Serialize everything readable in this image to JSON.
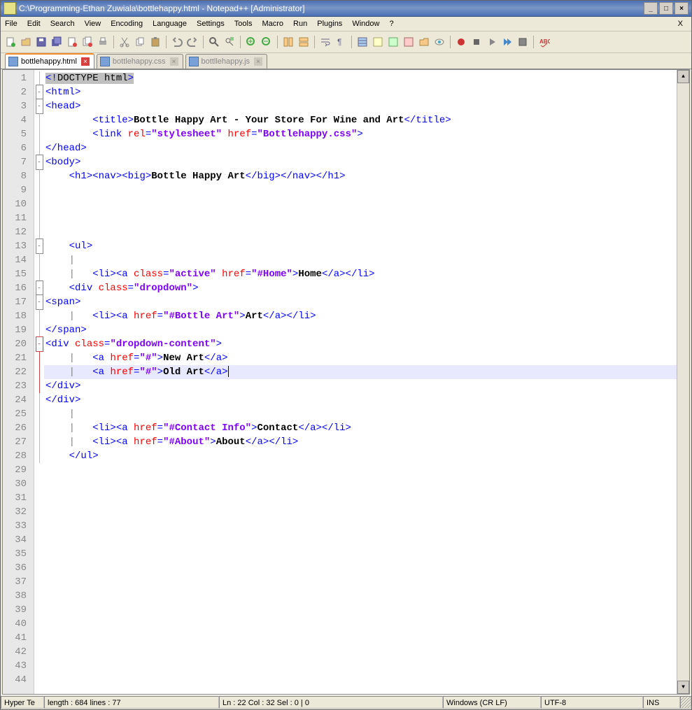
{
  "title": "C:\\Programming-Ethan Zuwiala\\bottlehappy.html - Notepad++ [Administrator]",
  "menus": [
    "File",
    "Edit",
    "Search",
    "View",
    "Encoding",
    "Language",
    "Settings",
    "Tools",
    "Macro",
    "Run",
    "Plugins",
    "Window",
    "?"
  ],
  "menu_x": "X",
  "tabs": [
    {
      "label": "bottlehappy.html",
      "active": true,
      "dirty": true
    },
    {
      "label": "bottlehappy.css",
      "active": false,
      "dirty": false
    },
    {
      "label": "bottllehappy.js",
      "active": false,
      "dirty": false
    }
  ],
  "line_count_visible": 44,
  "code": {
    "l1_decl": "<!DOCTYPE html>",
    "l2": {
      "tag": "html"
    },
    "l3": {
      "tag": "head"
    },
    "l4": {
      "indent": "        ",
      "tag": "title",
      "text": "Bottle Happy Art - Your Store For Wine and Art"
    },
    "l5": {
      "indent": "        ",
      "tag": "link",
      "attr_rel": "rel",
      "val_rel": "\"stylesheet\"",
      "attr_href": "href",
      "val_href": "\"Bottlehappy.css\""
    },
    "l6": {
      "close": "head"
    },
    "l7": {
      "tag": "body"
    },
    "l8": {
      "indent": "    ",
      "seq_open": [
        "h1",
        "nav",
        "big"
      ],
      "text": "Bottle Happy Art",
      "seq_close": [
        "big",
        "nav",
        "h1"
      ]
    },
    "l13": {
      "indent": "    ",
      "tag": "ul"
    },
    "l15": {
      "indent": "        ",
      "li": true,
      "a_attrs": [
        [
          "class",
          "\"active\""
        ],
        [
          "href",
          "\"#Home\""
        ]
      ],
      "text": "Home"
    },
    "l16": {
      "indent": "    ",
      "tag": "div",
      "attrs": [
        [
          "class",
          "\"dropdown\""
        ]
      ]
    },
    "l17": {
      "tag": "span"
    },
    "l18": {
      "indent": "        ",
      "li": true,
      "a_attrs": [
        [
          "href",
          "\"#Bottle Art\""
        ]
      ],
      "text": "Art"
    },
    "l19": {
      "close": "span"
    },
    "l20": {
      "tag": "div",
      "attrs": [
        [
          "class",
          "\"dropdown-content\""
        ]
      ]
    },
    "l21": {
      "indent": "        ",
      "a_attrs": [
        [
          "href",
          "\"#\""
        ]
      ],
      "text": "New Art"
    },
    "l22": {
      "indent": "        ",
      "a_attrs": [
        [
          "href",
          "\"#\""
        ]
      ],
      "text": "Old Art"
    },
    "l23": {
      "close": "div"
    },
    "l24": {
      "close": "div"
    },
    "l26": {
      "indent": "        ",
      "li": true,
      "a_attrs": [
        [
          "href",
          "\"#Contact Info\""
        ]
      ],
      "text": "Contact"
    },
    "l27": {
      "indent": "        ",
      "li": true,
      "a_attrs": [
        [
          "href",
          "\"#About\""
        ]
      ],
      "text": "About"
    },
    "l28": {
      "indent": "    ",
      "close": "ul"
    }
  },
  "status": {
    "lang": "Hyper Te",
    "len": "length : 684   lines : 77",
    "pos": "Ln : 22   Col : 32   Sel : 0 | 0",
    "eol": "Windows (CR LF)",
    "enc": "UTF-8",
    "ins": "INS"
  }
}
